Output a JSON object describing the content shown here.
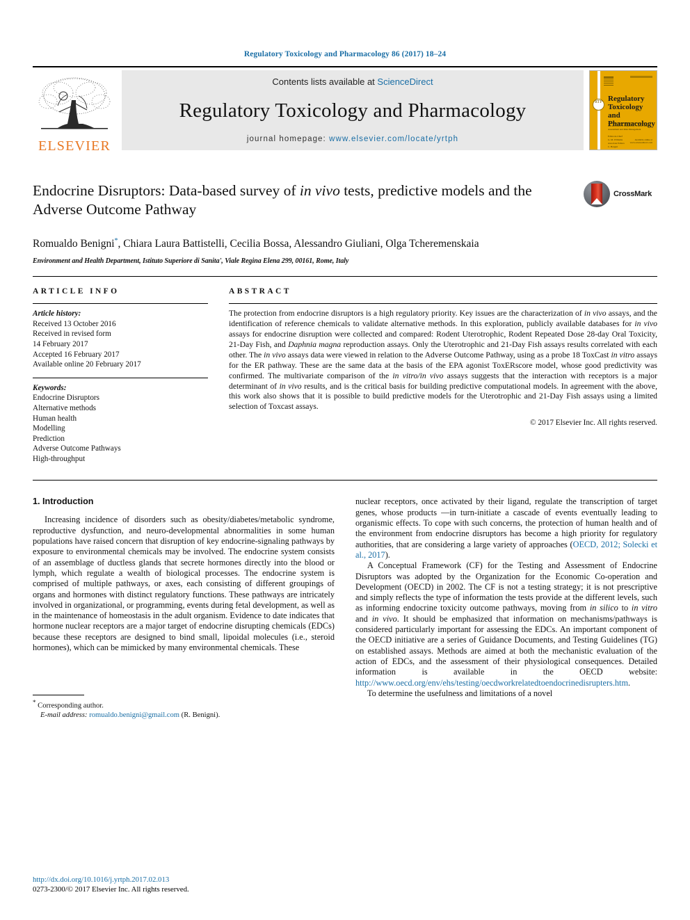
{
  "running_head": "Regulatory Toxicology and Pharmacology 86 (2017) 18–24",
  "masthead": {
    "publisher_name": "ELSEVIER",
    "contents_prefix": "Contents lists available at ",
    "contents_link": "ScienceDirect",
    "journal_title": "Regulatory Toxicology and Pharmacology",
    "homepage_prefix": "journal homepage: ",
    "homepage_url": "www.elsevier.com/locate/yrtph",
    "cover": {
      "badge": "RTP",
      "title": "Regulatory Toxicology and Pharmacology",
      "subtitle": "An International Journal Devoted to the Advancement of Regulatory Science, Risk Assessment and Risk Management",
      "list": "Editor-in-Chief\nG. M. Williams\nAssociate Editors\nC. Borgert\nR. L. Sielken\nK. Z. Travis\nA. R. Boobis",
      "bottom": "Available online at\nwww.sciencedirect.com"
    }
  },
  "article": {
    "title_part1": "Endocrine Disruptors: Data-based survey of ",
    "title_italic": "in vivo",
    "title_part2": " tests, predictive models and the Adverse Outcome Pathway",
    "crossmark_label": "CrossMark",
    "authors": "Romualdo Benigni",
    "authors_star": "*",
    "authors_rest": ", Chiara Laura Battistelli, Cecilia Bossa, Alessandro Giuliani, Olga Tcheremenskaia",
    "affiliation": "Environment and Health Department, Istituto Superiore di Sanita', Viale Regina Elena 299, 00161, Rome, Italy"
  },
  "article_info": {
    "heading": "ARTICLE INFO",
    "history_label": "Article history:",
    "history": [
      "Received 13 October 2016",
      "Received in revised form",
      "14 February 2017",
      "Accepted 16 February 2017",
      "Available online 20 February 2017"
    ],
    "keywords_label": "Keywords:",
    "keywords": [
      "Endocrine Disruptors",
      "Alternative methods",
      "Human health",
      "Modelling",
      "Prediction",
      "Adverse Outcome Pathways",
      "High-throughput"
    ]
  },
  "abstract": {
    "heading": "ABSTRACT",
    "paragraph_1": "The protection from endocrine disruptors is a high regulatory priority. Key issues are the characterization of ",
    "it_1": "in vivo",
    "paragraph_2": " assays, and the identification of reference chemicals to validate alternative methods. In this exploration, publicly available databases for ",
    "it_2": "in vivo",
    "paragraph_3": " assays for endocrine disruption were collected and compared: Rodent Uterotrophic, Rodent Repeated Dose 28-day Oral Toxicity, 21-Day Fish, and ",
    "it_3": "Daphnia magna",
    "paragraph_4": " reproduction assays. Only the Uterotrophic and 21-Day Fish assays results correlated with each other. The ",
    "it_4": "in vivo",
    "paragraph_5": " assays data were viewed in relation to the Adverse Outcome Pathway, using as a probe 18 ToxCast ",
    "it_5": "in vitro",
    "paragraph_6": " assays for the ER pathway. These are the same data at the basis of the EPA agonist ToxERscore model, whose good predictivity was confirmed. The multivariate comparison of the ",
    "it_6": "in vitro/in vivo",
    "paragraph_7": " assays suggests that the interaction with receptors is a major determinant of ",
    "it_7": "in vivo",
    "paragraph_8": " results, and is the critical basis for building predictive computational models. In agreement with the above, this work also shows that it is possible to build predictive models for the Uterotrophic and 21-Day Fish assays using a limited selection of Toxcast assays.",
    "copyright": "© 2017 Elsevier Inc. All rights reserved."
  },
  "introduction": {
    "section_title": "1. Introduction",
    "p1": "Increasing incidence of disorders such as obesity/diabetes/metabolic syndrome, reproductive dysfunction, and neuro-developmental abnormalities in some human populations have raised concern that disruption of key endocrine-signaling pathways by exposure to environmental chemicals may be involved. The endocrine system consists of an assemblage of ductless glands that secrete hormones directly into the blood or lymph, which regulate a wealth of biological processes. The endocrine system is comprised of multiple pathways, or axes, each consisting of different groupings of organs and hormones with distinct regulatory functions. These pathways are intricately involved in organizational, or programming, events during fetal development, as well as in the maintenance of homeostasis in the adult organism. Evidence to date indicates that hormone nuclear receptors are a major target of endocrine disrupting chemicals (EDCs) because these receptors are designed to bind small, lipoidal molecules (i.e., steroid hormones), which can be mimicked by many environmental chemicals. These",
    "p2_a": "nuclear receptors, once activated by their ligand, regulate the transcription of target genes, whose products —in turn-initiate a cascade of events eventually leading to organismic effects. To cope with such concerns, the protection of human health and of the environment from endocrine disruptors has become a high priority for regulatory authorities, that are considering a large variety of approaches (",
    "p2_cite": "OECD, 2012; Solecki et al., 2017",
    "p2_b": ").",
    "p3_a": "A Conceptual Framework (CF) for the Testing and Assessment of Endocrine Disruptors was adopted by the Organization for the Economic Co-operation and Development (OECD) in 2002. The CF is not a testing strategy; it is not prescriptive and simply reflects the type of information the tests provide at the different levels, such as informing endocrine toxicity outcome pathways, moving from ",
    "p3_it1": "in silico",
    "p3_b": " to ",
    "p3_it2": "in vitro",
    "p3_c": " and ",
    "p3_it3": "in vivo",
    "p3_d": ". It should be emphasized that information on mechanisms/pathways is considered particularly important for assessing the EDCs. An important component of the OECD initiative are a series of Guidance Documents, and Testing Guidelines (TG) on established assays. Methods are aimed at both the mechanistic evaluation of the action of EDCs, and the assessment of their physiological consequences. Detailed information is available in the OECD website: ",
    "p3_url": "http://www.oecd.org/env/ehs/testing/oecdworkrelatedtoendocrinedisrupters.htm",
    "p3_e": ".",
    "p4": "To determine the usefulness and limitations of a novel"
  },
  "footer": {
    "corresponding_star": "*",
    "corresponding_label": " Corresponding author.",
    "email_label": "E-mail address:",
    "email": "romualdo.benigni@gmail.com",
    "email_suffix": " (R. Benigni).",
    "doi": "http://dx.doi.org/10.1016/j.yrtph.2017.02.013",
    "issn_line": "0273-2300/© 2017 Elsevier Inc. All rights reserved."
  },
  "colors": {
    "link": "#1a6ea5",
    "elsevier_orange": "#E87722",
    "cover_yellow": "#E8A800"
  }
}
